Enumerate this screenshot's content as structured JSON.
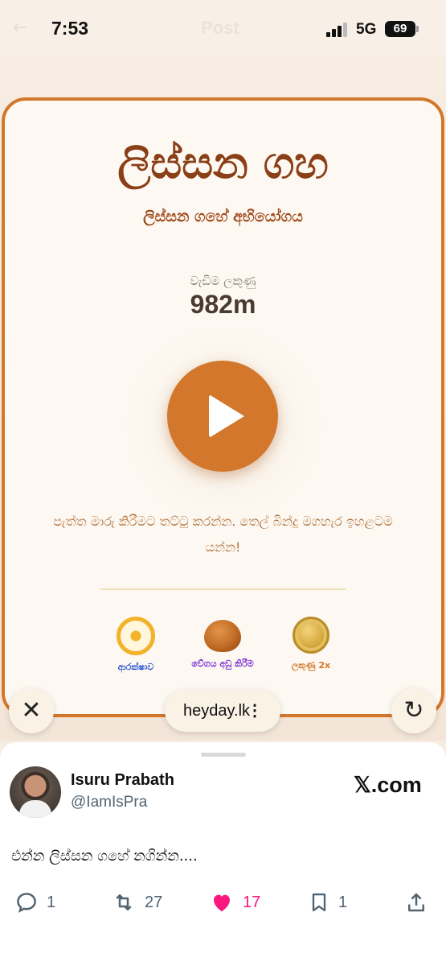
{
  "status_bar": {
    "time": "7:53",
    "network": "5G",
    "battery": "69",
    "ghost_title": "Post"
  },
  "game": {
    "title": "ලිස්සන ගහ",
    "subtitle": "ලිස්සන ගහේ අභියෝගය",
    "best_label": "වැඩිම ලකුණු",
    "best_value": "982m",
    "instructions": "පැත්ත මාරු කිරීමට තට්ටු කරන්න. තෙල් බින්දු මගහැර ඉහළටම යන්න!",
    "powerups": [
      {
        "label": "ආරක්ෂාව",
        "icon": "dharma-wheel-icon",
        "color": "#2f56d6"
      },
      {
        "label": "වේගය අඩු කිරීම",
        "icon": "oil-drop-icon",
        "color": "#7b2fd6"
      },
      {
        "label": "ලකුණු 2x",
        "icon": "gold-coin-icon",
        "color": "#d2772b"
      }
    ]
  },
  "browser": {
    "url": "heyday.lk",
    "menu_glyph": "⋮",
    "close_glyph": "✕",
    "reload_glyph": "↻"
  },
  "post": {
    "author_name": "Isuru Prabath",
    "author_handle": "@IamIsPra",
    "source": "𝕏.com",
    "text": "එන්න ලිස්සන ගහේ නගින්න....",
    "replies": "1",
    "reposts": "27",
    "likes": "17",
    "bookmarks": "1"
  },
  "colors": {
    "accent": "#d2772b",
    "title": "#8a3f17",
    "like": "#f91880"
  }
}
